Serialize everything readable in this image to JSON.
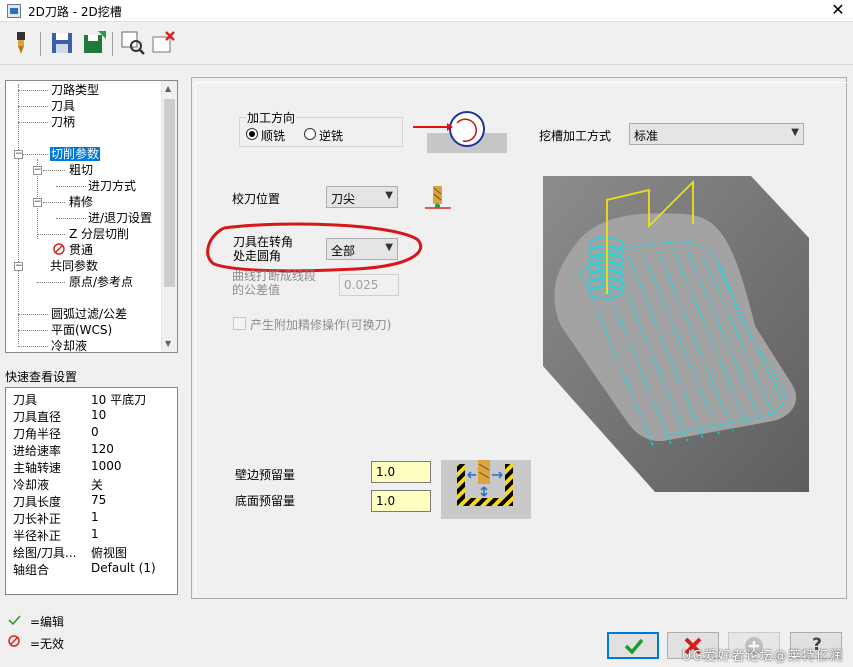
{
  "window": {
    "title": "2D刀路 - 2D挖槽",
    "close_glyph": "✕"
  },
  "toolbar": {
    "icons": [
      "tool-icon",
      "save-icon",
      "save-as-icon",
      "preview-icon",
      "disable-icon"
    ]
  },
  "tree": {
    "items": [
      {
        "label": "刀路类型"
      },
      {
        "label": "刀具"
      },
      {
        "label": "刀柄"
      },
      {
        "label": "切削参数",
        "selected": true
      },
      {
        "label": "粗切"
      },
      {
        "label": "进刀方式"
      },
      {
        "label": "精修"
      },
      {
        "label": "进/退刀设置"
      },
      {
        "label": "Z 分层切削"
      },
      {
        "label": "贯通",
        "status": "invalid"
      },
      {
        "label": "共同参数"
      },
      {
        "label": "原点/参考点"
      },
      {
        "label": "圆弧过滤/公差"
      },
      {
        "label": "平面(WCS)"
      },
      {
        "label": "冷却液"
      }
    ],
    "expander_minus": "−"
  },
  "quickview": {
    "title": "快速查看设置",
    "rows": [
      {
        "key": "刀具",
        "value": "10 平底刀"
      },
      {
        "key": "刀具直径",
        "value": "10"
      },
      {
        "key": "刀角半径",
        "value": "0"
      },
      {
        "key": "进给速率",
        "value": "120"
      },
      {
        "key": "主轴转速",
        "value": "1000"
      },
      {
        "key": "冷却液",
        "value": "关"
      },
      {
        "key": "刀具长度",
        "value": "75"
      },
      {
        "key": "刀长补正",
        "value": "1"
      },
      {
        "key": "半径补正",
        "value": "1"
      },
      {
        "key": "绘图/刀具...",
        "value": "俯视图"
      },
      {
        "key": "轴组合",
        "value": "Default (1)"
      }
    ]
  },
  "legend": {
    "edit_label": "=编辑",
    "invalid_label": "=无效"
  },
  "params": {
    "direction": {
      "label": "加工方向",
      "options": [
        {
          "label": "顺铣",
          "selected": true
        },
        {
          "label": "逆铣",
          "selected": false
        }
      ]
    },
    "slot_method": {
      "label": "挖槽加工方式",
      "value": "标准"
    },
    "tip_position": {
      "label": "校刀位置",
      "value": "刀尖"
    },
    "corner_rounding": {
      "label_line1": "刀具在转角",
      "label_line2": "处走圆角",
      "value": "全部"
    },
    "arc_tolerance": {
      "label_line1": "曲线打断成线段",
      "label_line2": "的公差值",
      "value": "0.025",
      "disabled": true
    },
    "extra_finish": {
      "label": "产生附加精修操作(可换刀)",
      "checked": false,
      "disabled": true
    },
    "wall_stock": {
      "label": "壁边预留量",
      "value": "1.0"
    },
    "floor_stock": {
      "label": "底面预留量",
      "value": "1.0"
    }
  },
  "buttons": [
    {
      "name": "ok-button",
      "icon": "checkmark-icon"
    },
    {
      "name": "cancel-button",
      "icon": "x-icon"
    },
    {
      "name": "add-button",
      "icon": "plus-icon",
      "disabled": true
    },
    {
      "name": "help-button",
      "icon": "question-icon",
      "glyph": "?"
    }
  ],
  "watermark": "UG爱好者论坛@莱特亿润",
  "colors": {
    "selection": "#0078d7",
    "edit_field": "#ffffc0",
    "annotation_red": "#d8171b",
    "toolpath": "#19d6e0"
  }
}
